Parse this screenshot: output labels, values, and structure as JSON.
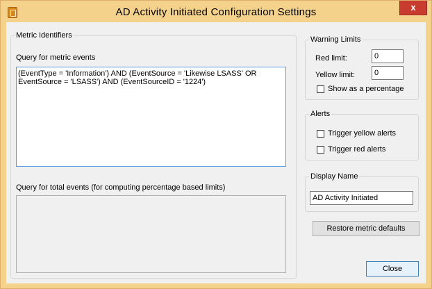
{
  "window": {
    "title": "AD Activity Initiated Configuration Settings",
    "close_glyph": "x"
  },
  "metric_identifiers": {
    "legend": "Metric Identifiers",
    "metric_query_label": "Query for metric events",
    "metric_query_value": "(EventType = 'Information') AND (EventSource = 'Likewise LSASS' OR EventSource = 'LSASS') AND (EventSourceID = '1224')",
    "total_query_label": "Query for total events (for computing percentage based limits)",
    "total_query_value": ""
  },
  "warning_limits": {
    "legend": "Warning Limits",
    "red_label": "Red limit:",
    "red_value": "0",
    "yellow_label": "Yellow limit:",
    "yellow_value": "0",
    "percentage_label": "Show as a percentage"
  },
  "alerts": {
    "legend": "Alerts",
    "yellow_label": "Trigger yellow alerts",
    "red_label": "Trigger red alerts"
  },
  "display_name": {
    "legend": "Display Name",
    "value": "AD Activity Initiated"
  },
  "buttons": {
    "restore": "Restore metric defaults",
    "close": "Close"
  },
  "colors": {
    "title_bar": "#f5d28c",
    "close_button": "#c73c2f",
    "focus_border": "#569de5"
  }
}
